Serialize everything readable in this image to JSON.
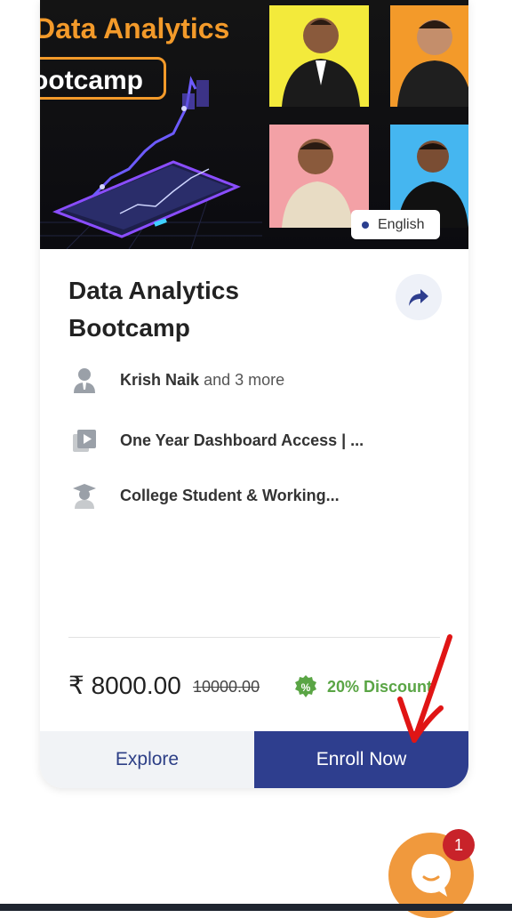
{
  "banner": {
    "title": "Data Analytics",
    "subtitle": "ootcamp",
    "language": "English"
  },
  "course": {
    "title": "Data Analytics Bootcamp"
  },
  "details": {
    "instructor_name": "Krish Naik",
    "instructor_more": "and 3 more",
    "access": "One Year Dashboard Access | ...",
    "audience": "College Student & Working..."
  },
  "pricing": {
    "price": "₹ 8000.00",
    "old_price": "10000.00",
    "discount": "20% Discount"
  },
  "actions": {
    "explore": "Explore",
    "enroll": "Enroll Now"
  },
  "chat": {
    "badge_count": "1"
  },
  "colors": {
    "brand_blue": "#2e3e8e",
    "accent_orange": "#f0993d",
    "discount_green": "#5aa545",
    "badge_red": "#c8232a"
  }
}
